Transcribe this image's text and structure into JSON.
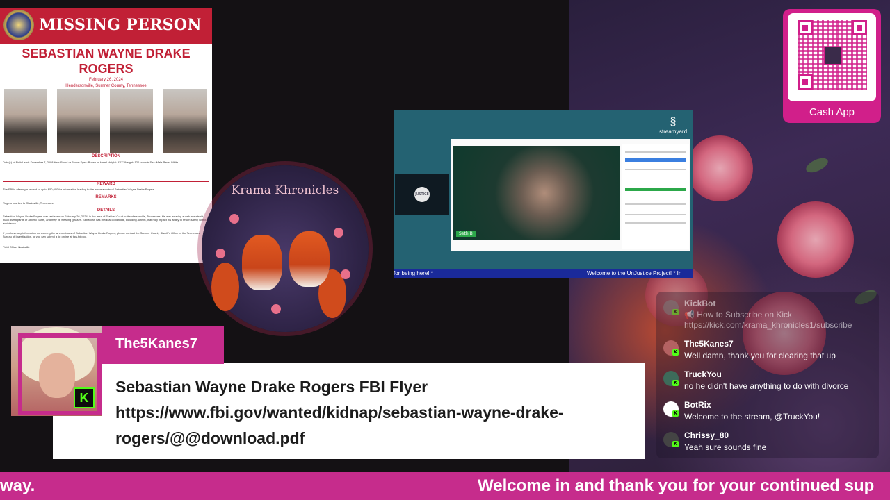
{
  "flyer": {
    "title": "MISSING PERSON",
    "name": "SEBASTIAN WAYNE DRAKE ROGERS",
    "date": "February 26, 2024",
    "location": "Hendersonville, Sumner County, Tennessee",
    "sections": {
      "description": "DESCRIPTION",
      "reward": "REWARD",
      "remarks": "REMARKS",
      "details": "DETAILS"
    },
    "description_text": "Date(s) of Birth Used: December 7, 2008   Hair: Blond or Brown   Eyes: Brown or Hazel   Height: 5'07\"   Weight: 120 pounds   Sex: Male   Race: White",
    "reward_text": "The FBI is offering a reward of up to $50,000 for information leading to the whereabouts of Sebastian Wayne Drake Rogers.",
    "remarks_text": "Rogers has ties to Clarksville, Tennessee.",
    "details_text": "Sebastian Wayne Drake Rogers was last seen on February 26, 2024, in the area of Stafford Court in Hendersonville, Tennessee. He was wearing a dark sweatshirt, black sweatpants or athletic pants, and may be wearing glasses. Sebastian has medical conditions, including autism, that may impact his ability to return safely without assistance.",
    "contact_text": "If you have any information concerning the whereabouts of Sebastian Wayne Drake Rogers, please contact the Sumner County Sheriff's Office or the Tennessee Bureau of Investigation, or you can submit a tip online at tips.fbi.gov.",
    "field_office": "Field Office: Nashville"
  },
  "logo": {
    "title": "Krama Khronicles"
  },
  "stream": {
    "brand": "streamyard",
    "guest_label": "JUSTICE",
    "cam_label": "Seth B",
    "ticker_left": "for being here! *",
    "ticker_right": "Welcome to the UnJustice Project! * In"
  },
  "cashapp": {
    "label": "Cash App"
  },
  "chat": {
    "messages": [
      {
        "user": "KickBot",
        "text1": "📢 How to Subscribe on Kick",
        "text2": "https://kick.com/krama_khronicles1/subscribe",
        "color": "#7a7a7a"
      },
      {
        "user": "The5Kanes7",
        "text1": "Well damn, thank you for clearing that up",
        "color": "#b46262"
      },
      {
        "user": "TruckYou",
        "text1": "no he didn't have anything to do with divorce",
        "color": "#3d6b5a"
      },
      {
        "user": "BotRix",
        "text1": "Welcome to the stream, @TruckYou!",
        "color": "#ffffff"
      },
      {
        "user": "Chrissy_80",
        "text1": "Yeah sure sounds fine",
        "color": "#444444"
      }
    ]
  },
  "featured": {
    "user": "The5Kanes7",
    "line1": "Sebastian Wayne Drake Rogers FBI Flyer",
    "line2": "https://www.fbi.gov/wanted/kidnap/sebastian-wayne-drake-",
    "line3": "rogers/@@download.pdf",
    "kick_icon": "K"
  },
  "ticker": {
    "left": "way.",
    "right": "Welcome in and thank you for your continued sup"
  },
  "colors": {
    "brand": "#c62c8c",
    "kick": "#53fc18",
    "fbi_red": "#c12036"
  }
}
